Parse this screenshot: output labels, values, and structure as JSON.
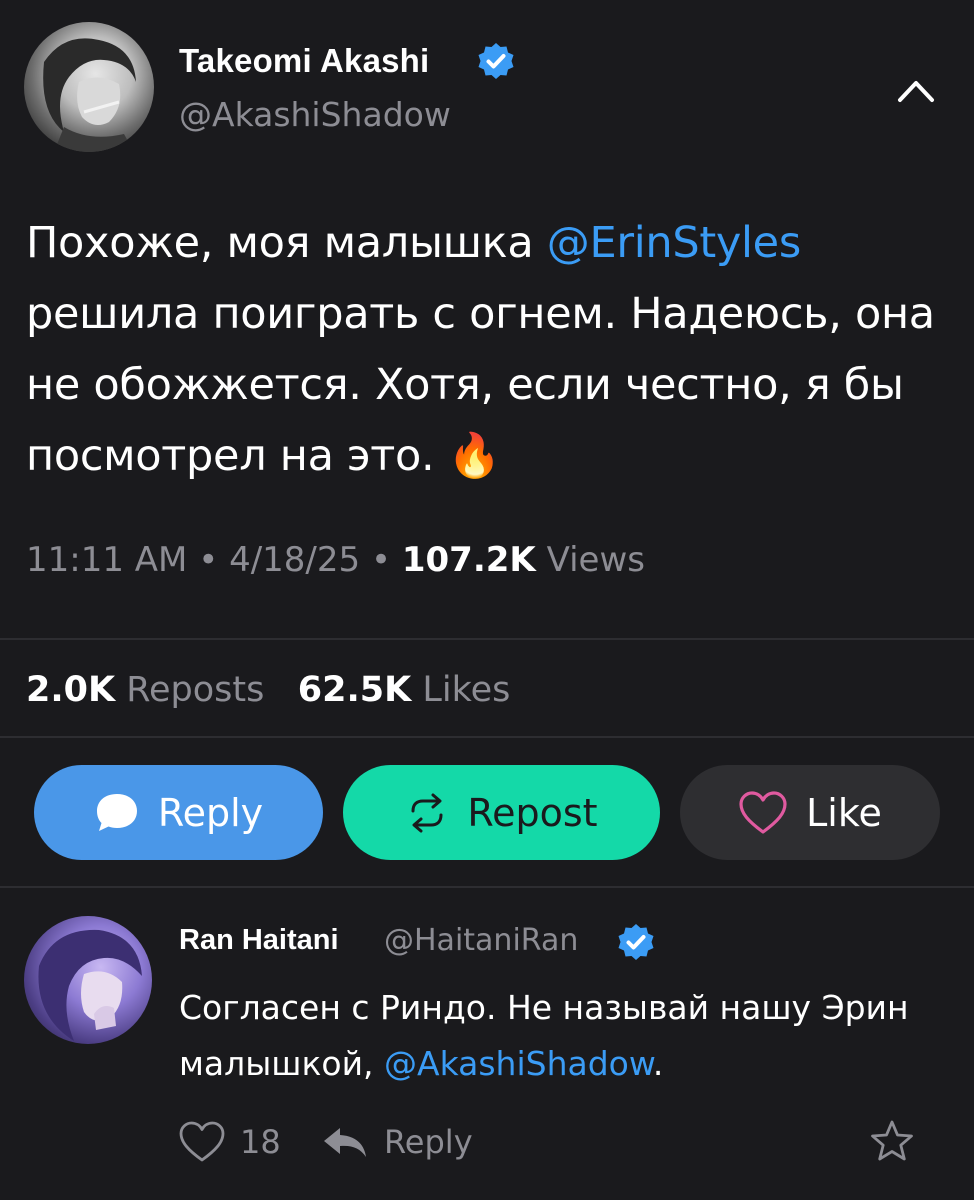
{
  "tweet": {
    "author": {
      "name": "Takeomi Akashi",
      "handle": "@AkashiShadow",
      "verified": true,
      "avatar_icon": "avatar-image"
    },
    "text_before_mention": "Похоже, моя малышка ",
    "mention": "@ErinStyles",
    "text_after_mention": " решила поиграть с огнем. Надеюсь, она не обожжется. Хотя, если честно, я бы посмотрел на это. ",
    "emoji": "🔥",
    "time": "11:11 AM",
    "date": "4/18/25",
    "views_count": "107.2K",
    "views_label": "Views",
    "separator": "•",
    "reposts_count": "2.0K",
    "reposts_label": "Reposts",
    "likes_count": "62.5K",
    "likes_label": "Likes"
  },
  "actions": {
    "reply_label": "Reply",
    "repost_label": "Repost",
    "like_label": "Like",
    "colors": {
      "reply": "#4a97e8",
      "repost": "#14d9a8",
      "like": "#2e2e31"
    }
  },
  "reply": {
    "author": {
      "name": "Ran Haitani",
      "handle": "@HaitaniRan",
      "verified": true
    },
    "text_before_mention": "Согласен с Риндо. Не называй нашу Эрин малышкой, ",
    "mention": "@AkashiShadow",
    "text_after_mention": ".",
    "likes_count": "18",
    "reply_label": "Reply"
  },
  "colors": {
    "background": "#1a1a1d",
    "accent_blue": "#3b9cf5",
    "muted_text": "#8d8d94"
  }
}
